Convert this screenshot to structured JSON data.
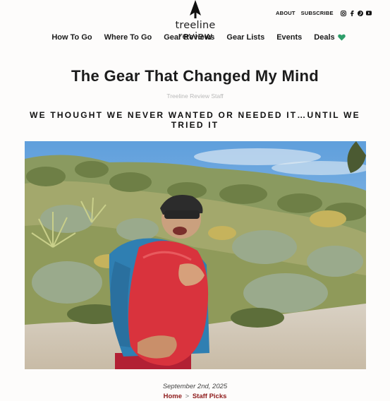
{
  "site": {
    "name": "treeline review"
  },
  "utility": {
    "about": "ABOUT",
    "subscribe": "SUBSCRIBE",
    "social": [
      "instagram-icon",
      "facebook-icon",
      "pinterest-icon",
      "youtube-icon"
    ]
  },
  "nav": {
    "items": [
      "How To Go",
      "Where To Go",
      "Gear Reviews",
      "Gear Lists",
      "Events",
      "Deals"
    ]
  },
  "article": {
    "title": "The Gear That Changed My Mind",
    "author": "Treeline Review Staff",
    "subtitle": "WE THOUGHT WE NEVER WANTED OR NEEDED IT…UNTIL WE TRIED IT",
    "date": "September 2nd, 2025",
    "breadcrumb": {
      "home": "Home",
      "separator": ">",
      "category": "Staff Picks"
    }
  },
  "colors": {
    "accent": "#8e1b1b",
    "deals_heart": "#2e9e6a"
  }
}
